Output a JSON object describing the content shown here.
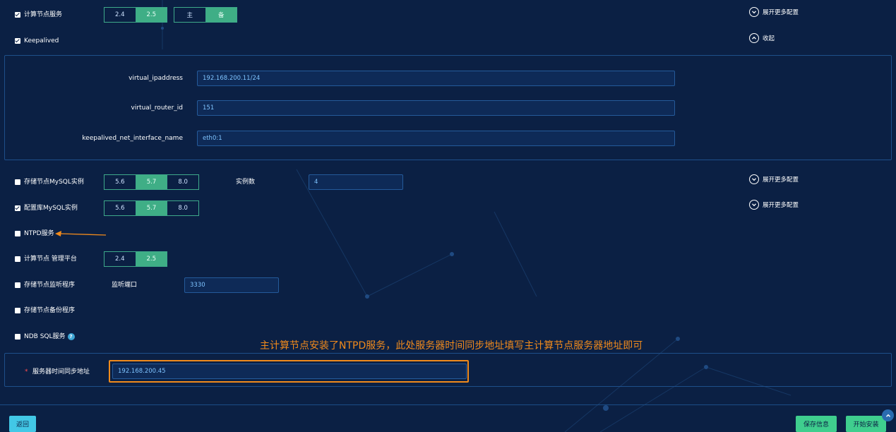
{
  "compute_service": {
    "label": "计算节点服务",
    "checked": true,
    "versions": [
      "2.4",
      "2.5"
    ],
    "version_selected": "2.5",
    "roles": [
      "主",
      "备"
    ],
    "role_selected": "备",
    "expand_label": "展开更多配置"
  },
  "keepalived": {
    "label": "Keepalived",
    "checked": true,
    "collapse_label": "收起",
    "fields": [
      {
        "label": "virtual_ipaddress",
        "value": "192.168.200.11/24"
      },
      {
        "label": "virtual_router_id",
        "value": "151"
      },
      {
        "label": "keepalived_net_interface_name",
        "value": "eth0:1"
      }
    ]
  },
  "storage_mysql": {
    "label": "存储节点MySQL实例",
    "checked": false,
    "versions": [
      "5.6",
      "5.7",
      "8.0"
    ],
    "version_selected": "5.7",
    "instances_label": "实例数",
    "instances_value": "4",
    "expand_label": "展开更多配置"
  },
  "config_mysql": {
    "label": "配置库MySQL实例",
    "checked": true,
    "versions": [
      "5.6",
      "5.7",
      "8.0"
    ],
    "version_selected": "5.7",
    "expand_label": "展开更多配置"
  },
  "ntpd": {
    "label": "NTPD服务",
    "checked": false
  },
  "mgmt_platform": {
    "label": "计算节点 管理平台",
    "checked": false,
    "versions": [
      "2.4",
      "2.5"
    ],
    "version_selected": "2.5"
  },
  "storage_monitor": {
    "label": "存储节点监听程序",
    "checked": false,
    "port_label": "监听端口",
    "port_value": "3330"
  },
  "storage_backup": {
    "label": "存储节点备份程序",
    "checked": false
  },
  "ndb_sql": {
    "label": "NDB SQL服务",
    "checked": false,
    "help_icon": "question-icon"
  },
  "annotation": {
    "text": "主计算节点安装了NTPD服务，此处服务器时间同步地址填写主计算节点服务器地址即可",
    "color": "#f08a1c"
  },
  "time_sync": {
    "required_mark": "*",
    "label": "服务器时间同步地址",
    "value": "192.168.200.45"
  },
  "footer": {
    "back_label": "返回",
    "save_label": "保存信息",
    "install_label": "开始安装"
  },
  "colors": {
    "background": "#0b2044",
    "accent_green": "#3fae86",
    "input_text": "#7fc4ff",
    "back_button": "#42c8e6",
    "annotation_orange": "#f08a1c"
  }
}
